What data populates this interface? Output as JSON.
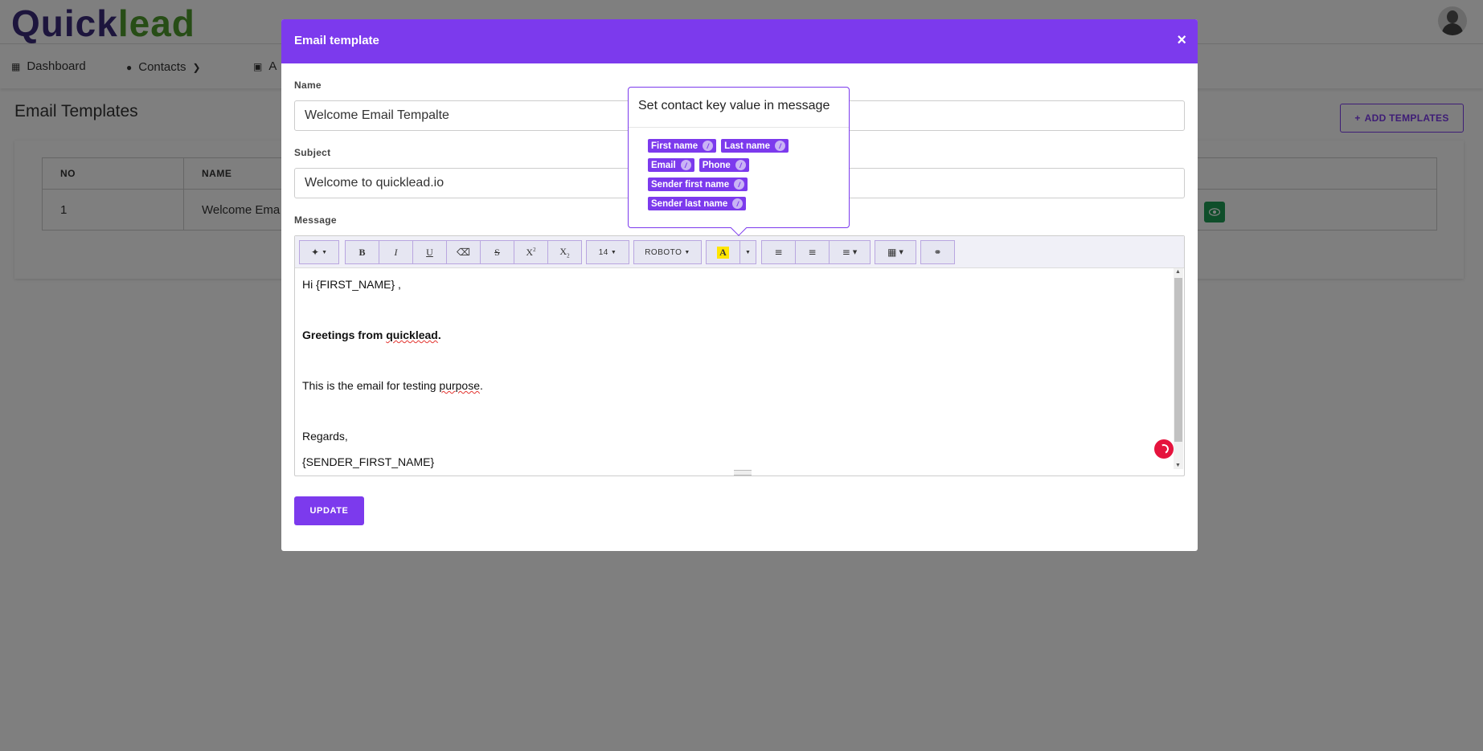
{
  "app": {
    "logo_part1": "Quick",
    "logo_part2": "lead"
  },
  "nav": {
    "dashboard": "Dashboard",
    "contacts": "Contacts",
    "third_partial": "A"
  },
  "page": {
    "title": "Email Templates",
    "add_button": "ADD TEMPLATES",
    "table": {
      "headers": [
        "NO",
        "NAME"
      ],
      "rows": [
        {
          "no": "1",
          "name": "Welcome Ema"
        }
      ]
    }
  },
  "modal": {
    "title": "Email template",
    "close": "×",
    "name_label": "Name",
    "name_value": "Welcome Email Tempalte",
    "subject_label": "Subject",
    "subject_value": "Welcome to quicklead.io",
    "message_label": "Message",
    "toolbar": {
      "font_size": "14",
      "font_family": "ROBOTO",
      "highlight_letter": "A"
    },
    "message": {
      "line1": "Hi {FIRST_NAME} ,",
      "line2_prefix": "Greetings from ",
      "line2_word": "quicklead",
      "line2_suffix": ".",
      "line3_prefix": "This is the email for testing ",
      "line3_word": "purpose",
      "line3_suffix": ".",
      "line4": "Regards,",
      "line5": "{SENDER_FIRST_NAME}"
    },
    "update_button": "UPDATE"
  },
  "popover": {
    "title": "Set contact key value in message",
    "chips": [
      "First name",
      "Last name",
      "Email",
      "Phone",
      "Sender first name",
      "Sender last name"
    ]
  },
  "colors": {
    "primary": "#7c3aed",
    "success": "#1f9d55",
    "record": "#e5133d",
    "logo_dark": "#3b2a7a",
    "logo_green": "#4e9a2d"
  }
}
